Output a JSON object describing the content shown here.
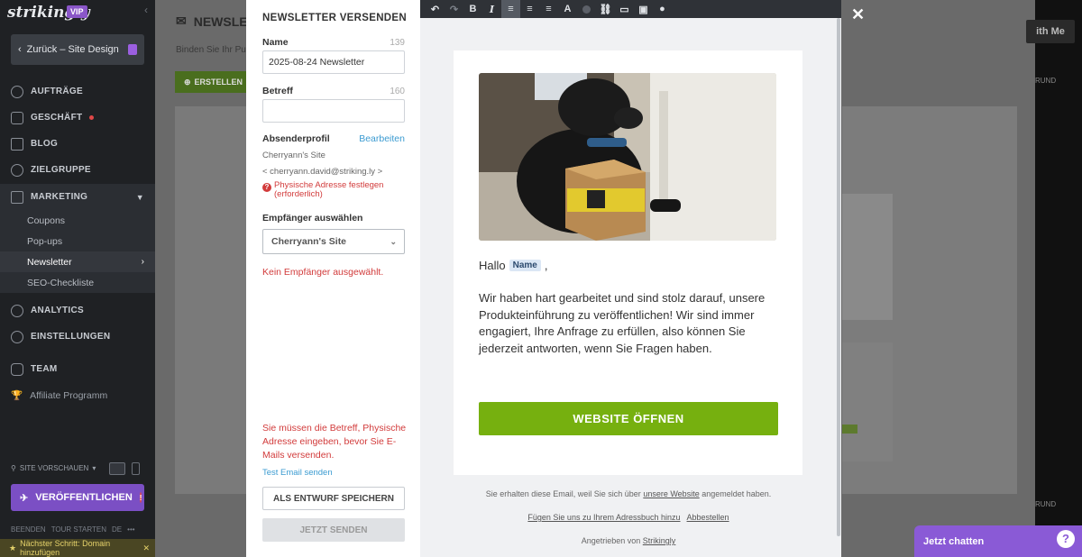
{
  "sidebar": {
    "logo": "strikingly",
    "vip": "VIP",
    "back_label": "Zurück – Site Design",
    "nav": [
      {
        "label": "AUFTRÄGE"
      },
      {
        "label": "GESCHÄFT"
      },
      {
        "label": "BLOG"
      },
      {
        "label": "ZIELGRUPPE"
      },
      {
        "label": "MARKETING"
      },
      {
        "label": "ANALYTICS"
      },
      {
        "label": "EINSTELLUNGEN"
      },
      {
        "label": "TEAM"
      }
    ],
    "sub_items": [
      "Coupons",
      "Pop-ups",
      "Newsletter",
      "SEO-Checkliste"
    ],
    "affiliate": "Affiliate Programm",
    "site_preview": "SITE VORSCHAUEN",
    "publish": "VERÖFFENTLICHEN",
    "tour": [
      "BEENDEN",
      "TOUR STARTEN",
      "DE"
    ],
    "next_step": "Nächster Schritt: Domain hinzufügen"
  },
  "background": {
    "title": "NEWSLE",
    "subtitle": "Binden Sie Ihr Pu",
    "create": "ERSTELLEN",
    "with_me": "ith Me",
    "grund": "RUND"
  },
  "modal": {
    "title": "NEWSLETTER VERSENDEN",
    "name_label": "Name",
    "name_count": "139",
    "name_value": "2025-08-24 Newsletter",
    "subject_label": "Betreff",
    "subject_count": "160",
    "subject_value": "",
    "sender_label": "Absenderprofil",
    "edit": "Bearbeiten",
    "sender_name": "Cherryann's Site",
    "sender_email": "< cherryann.david@striking.ly >",
    "address_error": "Physische Adresse festlegen (erforderlich)",
    "recipients_label": "Empfänger auswählen",
    "recipients_value": "Cherryann's Site",
    "no_recipient": "Kein Empfänger ausgewählt.",
    "required_msg": "Sie müssen die Betreff, Physische Adresse eingeben, bevor Sie E-Mails versenden.",
    "test_email": "Test Email senden",
    "save_draft": "ALS ENTWURF SPEICHERN",
    "send_now": "JETZT SENDEN"
  },
  "email": {
    "greeting": "Hallo",
    "name_tag": "Name",
    "comma": ",",
    "body": "Wir haben hart gearbeitet und sind stolz darauf, unsere Produkteinführung zu veröffentlichen! Wir sind immer  engagiert, Ihre Anfrage zu erfüllen, also können Sie jederzeit antworten, wenn Sie Fragen haben.",
    "cta": "WEBSITE ÖFFNEN",
    "footer_1": "Sie erhalten diese Email, weil Sie sich über",
    "footer_1_link": "unsere Website",
    "footer_1_end": "angemeldet haben.",
    "footer_2a": "Fügen Sie uns zu Ihrem Adressbuch hinzu",
    "footer_2b": "Abbestellen",
    "footer_3": "Angetrieben von",
    "footer_3_link": "Strikingly"
  },
  "chat": {
    "label": "Jetzt chatten",
    "help": "?"
  },
  "colors": {
    "accent_green": "#76b00f",
    "purple": "#8a5ad6",
    "error_red": "#d23b3b",
    "link_blue": "#3b9bd1"
  }
}
